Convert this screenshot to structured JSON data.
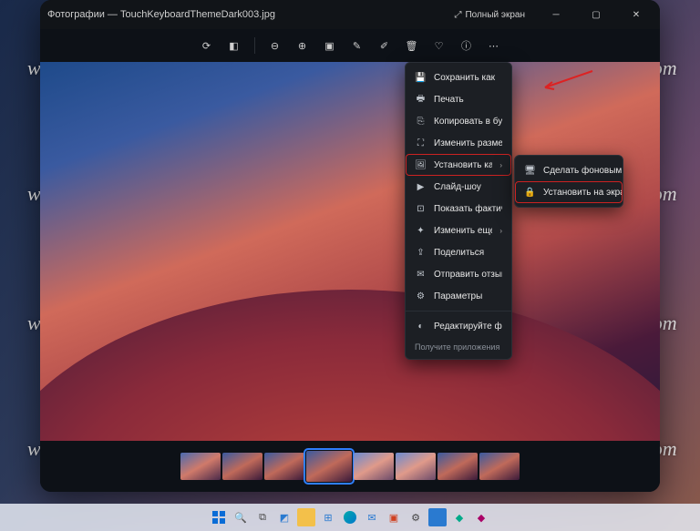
{
  "window": {
    "app_name": "Фотографии",
    "file_name": "TouchKeyboardThemeDark003.jpg",
    "fullscreen_label": "Полный экран"
  },
  "toolbar": {
    "icons": [
      "rotate-icon",
      "compare-icon",
      "zoom-out-icon",
      "zoom-in-icon",
      "slideshow-icon",
      "edit-icon",
      "draw-icon",
      "delete-icon",
      "favorite-icon",
      "info-icon",
      "more-icon"
    ]
  },
  "menu": {
    "items": [
      {
        "icon": "save-icon",
        "label": "Сохранить как"
      },
      {
        "icon": "print-icon",
        "label": "Печать"
      },
      {
        "icon": "copy-icon",
        "label": "Копировать в буфер обмена"
      },
      {
        "icon": "resize-icon",
        "label": "Изменить размер"
      },
      {
        "icon": "setas-icon",
        "label": "Установить как",
        "submenu": true,
        "highlight": true
      },
      {
        "icon": "slideshow-icon",
        "label": "Слайд-шоу"
      },
      {
        "icon": "actual-icon",
        "label": "Показать фактический размер"
      },
      {
        "icon": "editmore-icon",
        "label": "Изменить еще...",
        "submenu": true
      },
      {
        "icon": "share-icon",
        "label": "Поделиться"
      },
      {
        "icon": "feedback-icon",
        "label": "Отправить отзыв"
      },
      {
        "icon": "settings-icon",
        "label": "Параметры"
      }
    ],
    "footer_title": "Редактируйте фотографии",
    "footer_sub": "Получите приложения с"
  },
  "submenu": {
    "items": [
      {
        "icon": "desktop-icon",
        "label": "Сделать фоновым изображением"
      },
      {
        "icon": "lock-icon",
        "label": "Установить на экран блокировки",
        "highlight": true
      }
    ]
  },
  "watermark": "winreviewer.com",
  "taskbar_icons": [
    "start",
    "search",
    "taskview",
    "widgets",
    "explorer",
    "store",
    "edge",
    "mail",
    "office",
    "settings",
    "photos",
    "paint",
    "terminal"
  ]
}
